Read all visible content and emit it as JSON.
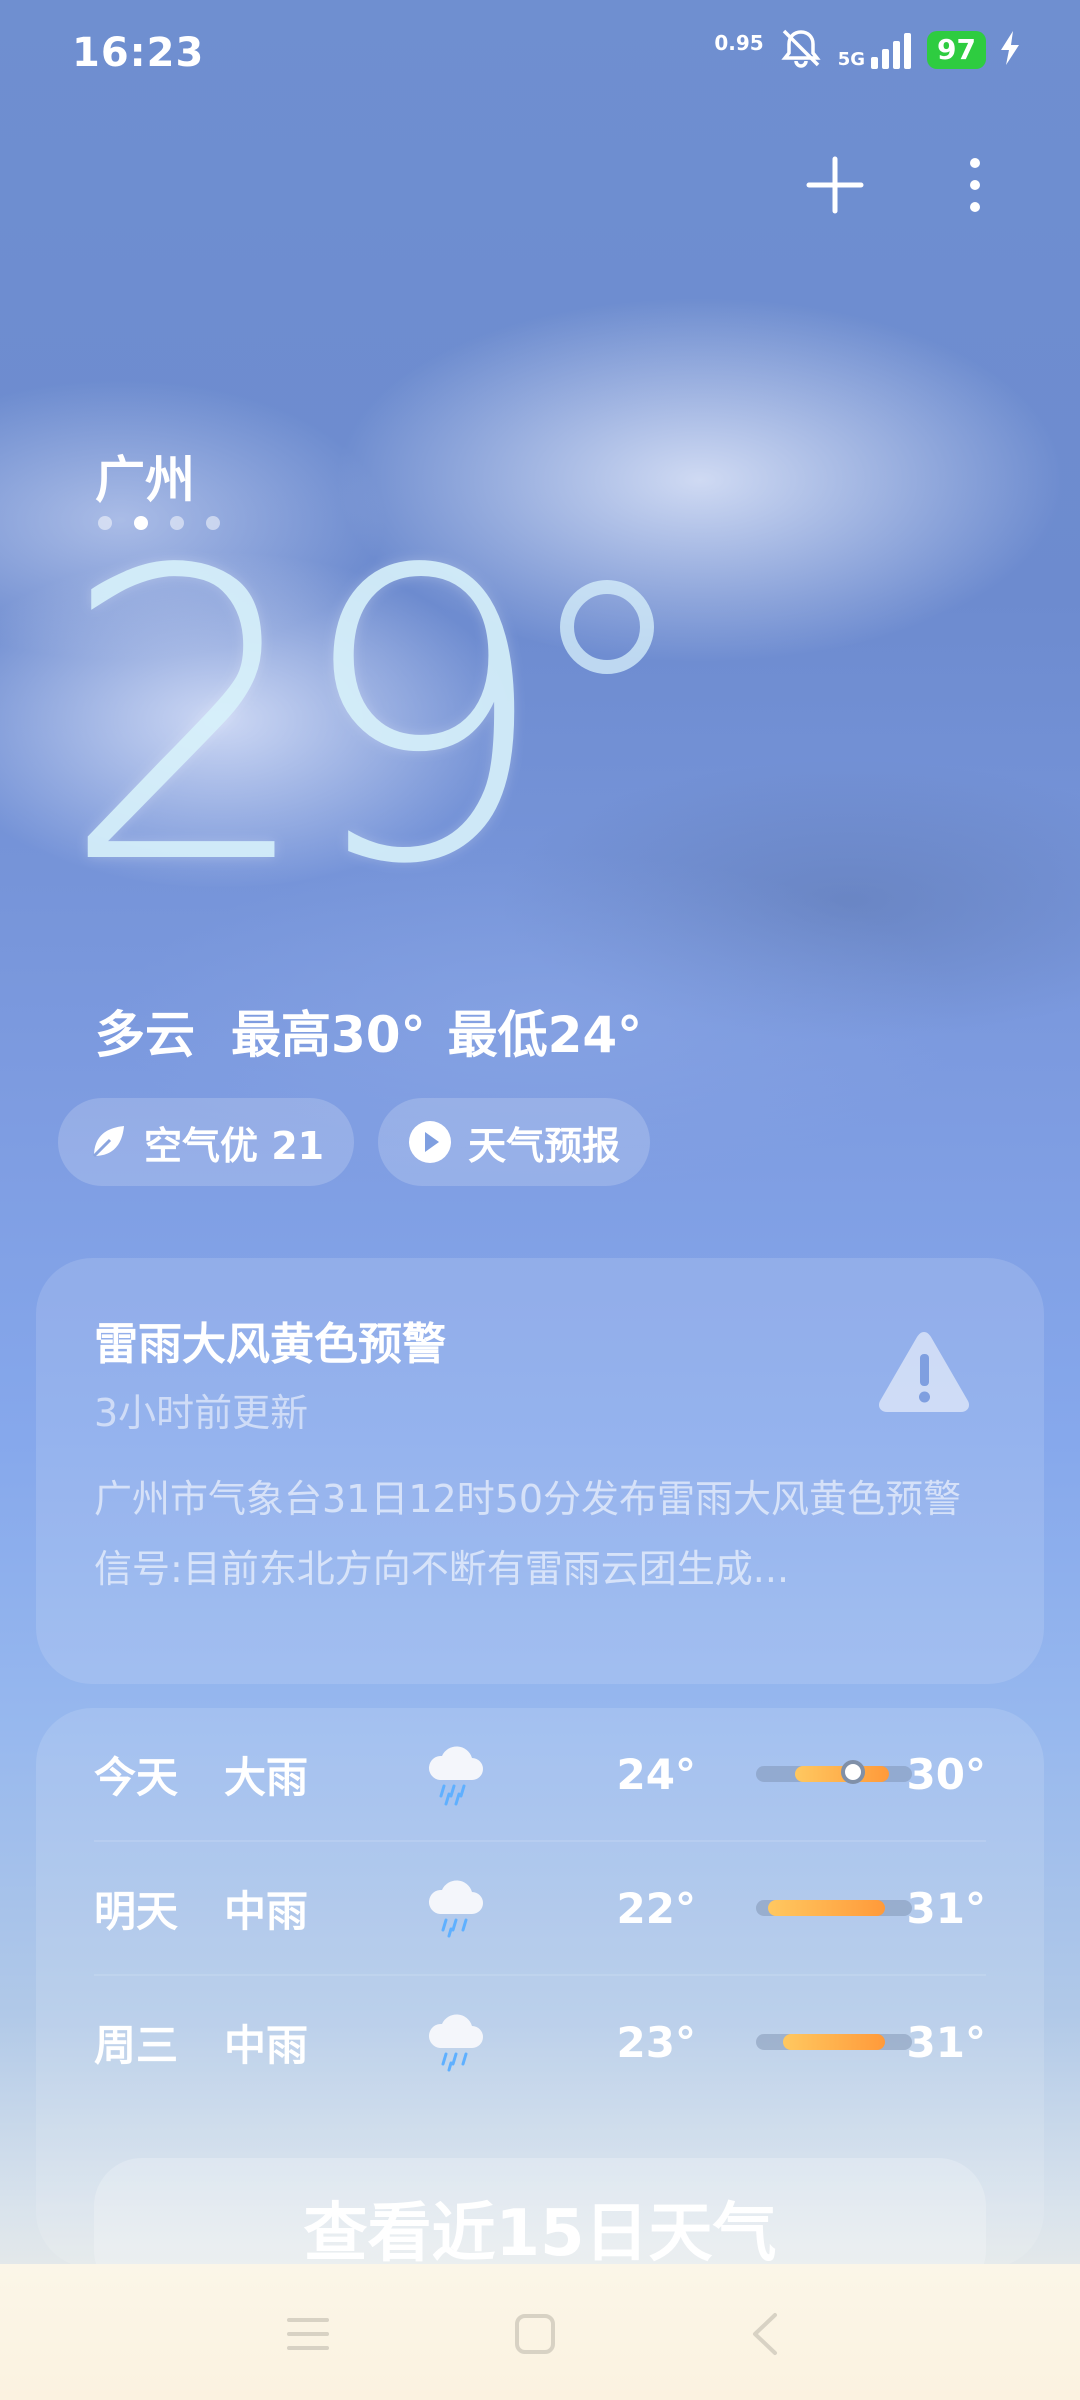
{
  "status_bar": {
    "time": "16:23",
    "speed": "0.95",
    "network": "5G",
    "battery": "97"
  },
  "location": {
    "city": "广州",
    "page_count": 4,
    "active_index": 1
  },
  "current": {
    "temp": "29",
    "condition": "多云",
    "high": "最高30°",
    "low": "最低24°"
  },
  "pills": {
    "air": "空气优 21",
    "forecast": "天气预报"
  },
  "alert": {
    "title": "雷雨大风黄色预警",
    "updated": "3小时前更新",
    "body": "广州市气象台31日12时50分发布雷雨大风黄色预警信号:目前东北方向不断有雷雨云团生成..."
  },
  "forecast": {
    "days": [
      {
        "day": "今天",
        "condition": "大雨",
        "low": "24°",
        "high": "30°",
        "fill_start": 0.25,
        "fill_end": 0.85,
        "now": 0.62
      },
      {
        "day": "明天",
        "condition": "中雨",
        "low": "22°",
        "high": "31°",
        "fill_start": 0.08,
        "fill_end": 0.83
      },
      {
        "day": "周三",
        "condition": "中雨",
        "low": "23°",
        "high": "31°",
        "fill_start": 0.17,
        "fill_end": 0.83
      }
    ],
    "more_label": "查看近15日天气"
  },
  "colors": {
    "accent_orange": "#ff9a3a",
    "battery_green": "#2ecc40"
  }
}
